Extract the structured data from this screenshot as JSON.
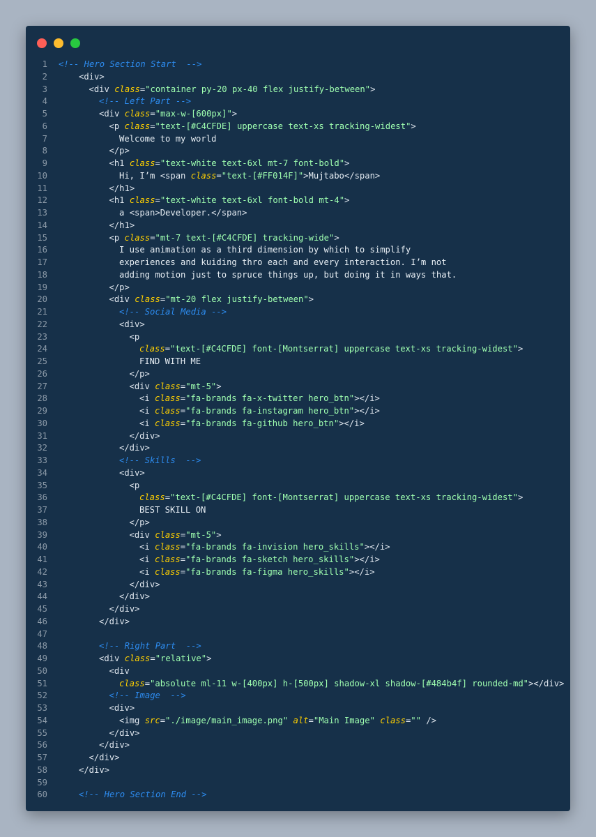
{
  "window": {
    "title_buttons": [
      "close",
      "minimize",
      "zoom"
    ],
    "colors": {
      "background": "#163049",
      "comment": "#2D8CF0",
      "tag": "#DFE6EE",
      "attr": "#FFD000",
      "string": "#9FFFB0",
      "line_number": "#8C9AA8"
    }
  },
  "code": {
    "lines": [
      {
        "n": "1",
        "indent": 0,
        "segs": [
          {
            "k": "c",
            "v": "<!-- Hero Section Start  -->"
          }
        ]
      },
      {
        "n": "2",
        "indent": 2,
        "segs": [
          {
            "k": "t",
            "v": "<div>"
          }
        ]
      },
      {
        "n": "3",
        "indent": 3,
        "segs": [
          {
            "k": "t",
            "v": "<div "
          },
          {
            "k": "a",
            "v": "class"
          },
          {
            "k": "t",
            "v": "="
          },
          {
            "k": "s",
            "v": "\"container py-20 px-40 flex justify-between\""
          },
          {
            "k": "t",
            "v": ">"
          }
        ]
      },
      {
        "n": "4",
        "indent": 4,
        "segs": [
          {
            "k": "c",
            "v": "<!-- Left Part -->"
          }
        ]
      },
      {
        "n": "5",
        "indent": 4,
        "segs": [
          {
            "k": "t",
            "v": "<div "
          },
          {
            "k": "a",
            "v": "class"
          },
          {
            "k": "t",
            "v": "="
          },
          {
            "k": "s",
            "v": "\"max-w-[600px]\""
          },
          {
            "k": "t",
            "v": ">"
          }
        ]
      },
      {
        "n": "6",
        "indent": 5,
        "segs": [
          {
            "k": "t",
            "v": "<p "
          },
          {
            "k": "a",
            "v": "class"
          },
          {
            "k": "t",
            "v": "="
          },
          {
            "k": "s",
            "v": "\"text-[#C4CFDE] uppercase text-xs tracking-widest\""
          },
          {
            "k": "t",
            "v": ">"
          }
        ]
      },
      {
        "n": "7",
        "indent": 6,
        "segs": [
          {
            "k": "p",
            "v": "Welcome to my world"
          }
        ]
      },
      {
        "n": "8",
        "indent": 5,
        "segs": [
          {
            "k": "t",
            "v": "</p>"
          }
        ]
      },
      {
        "n": "9",
        "indent": 5,
        "segs": [
          {
            "k": "t",
            "v": "<h1 "
          },
          {
            "k": "a",
            "v": "class"
          },
          {
            "k": "t",
            "v": "="
          },
          {
            "k": "s",
            "v": "\"text-white text-6xl mt-7 font-bold\""
          },
          {
            "k": "t",
            "v": ">"
          }
        ]
      },
      {
        "n": "10",
        "indent": 6,
        "segs": [
          {
            "k": "p",
            "v": "Hi, I’m "
          },
          {
            "k": "t",
            "v": "<span "
          },
          {
            "k": "a",
            "v": "class"
          },
          {
            "k": "t",
            "v": "="
          },
          {
            "k": "s",
            "v": "\"text-[#FF014F]\""
          },
          {
            "k": "t",
            "v": ">"
          },
          {
            "k": "p",
            "v": "Mujtabo"
          },
          {
            "k": "t",
            "v": "</span>"
          }
        ]
      },
      {
        "n": "11",
        "indent": 5,
        "segs": [
          {
            "k": "t",
            "v": "</h1>"
          }
        ]
      },
      {
        "n": "12",
        "indent": 5,
        "segs": [
          {
            "k": "t",
            "v": "<h1 "
          },
          {
            "k": "a",
            "v": "class"
          },
          {
            "k": "t",
            "v": "="
          },
          {
            "k": "s",
            "v": "\"text-white text-6xl font-bold mt-4\""
          },
          {
            "k": "t",
            "v": ">"
          }
        ]
      },
      {
        "n": "13",
        "indent": 6,
        "segs": [
          {
            "k": "p",
            "v": "a "
          },
          {
            "k": "t",
            "v": "<span>"
          },
          {
            "k": "p",
            "v": "Developer."
          },
          {
            "k": "t",
            "v": "</span>"
          }
        ]
      },
      {
        "n": "14",
        "indent": 5,
        "segs": [
          {
            "k": "t",
            "v": "</h1>"
          }
        ]
      },
      {
        "n": "15",
        "indent": 5,
        "segs": [
          {
            "k": "t",
            "v": "<p "
          },
          {
            "k": "a",
            "v": "class"
          },
          {
            "k": "t",
            "v": "="
          },
          {
            "k": "s",
            "v": "\"mt-7 text-[#C4CFDE] tracking-wide\""
          },
          {
            "k": "t",
            "v": ">"
          }
        ]
      },
      {
        "n": "16",
        "indent": 6,
        "segs": [
          {
            "k": "p",
            "v": "I use animation as a third dimension by which to simplify"
          }
        ]
      },
      {
        "n": "17",
        "indent": 6,
        "segs": [
          {
            "k": "p",
            "v": "experiences and kuiding thro each and every interaction. I’m not"
          }
        ]
      },
      {
        "n": "18",
        "indent": 6,
        "segs": [
          {
            "k": "p",
            "v": "adding motion just to spruce things up, but doing it in ways that."
          }
        ]
      },
      {
        "n": "19",
        "indent": 5,
        "segs": [
          {
            "k": "t",
            "v": "</p>"
          }
        ]
      },
      {
        "n": "20",
        "indent": 5,
        "segs": [
          {
            "k": "t",
            "v": "<div "
          },
          {
            "k": "a",
            "v": "class"
          },
          {
            "k": "t",
            "v": "="
          },
          {
            "k": "s",
            "v": "\"mt-20 flex justify-between\""
          },
          {
            "k": "t",
            "v": ">"
          }
        ]
      },
      {
        "n": "21",
        "indent": 6,
        "segs": [
          {
            "k": "c",
            "v": "<!-- Social Media -->"
          }
        ]
      },
      {
        "n": "22",
        "indent": 6,
        "segs": [
          {
            "k": "t",
            "v": "<div>"
          }
        ]
      },
      {
        "n": "23",
        "indent": 7,
        "segs": [
          {
            "k": "t",
            "v": "<p"
          }
        ]
      },
      {
        "n": "24",
        "indent": 8,
        "segs": [
          {
            "k": "a",
            "v": "class"
          },
          {
            "k": "t",
            "v": "="
          },
          {
            "k": "s",
            "v": "\"text-[#C4CFDE] font-[Montserrat] uppercase text-xs tracking-widest\""
          },
          {
            "k": "t",
            "v": ">"
          }
        ]
      },
      {
        "n": "25",
        "indent": 8,
        "segs": [
          {
            "k": "p",
            "v": "FIND WITH ME"
          }
        ]
      },
      {
        "n": "26",
        "indent": 7,
        "segs": [
          {
            "k": "t",
            "v": "</p>"
          }
        ]
      },
      {
        "n": "27",
        "indent": 7,
        "segs": [
          {
            "k": "t",
            "v": "<div "
          },
          {
            "k": "a",
            "v": "class"
          },
          {
            "k": "t",
            "v": "="
          },
          {
            "k": "s",
            "v": "\"mt-5\""
          },
          {
            "k": "t",
            "v": ">"
          }
        ]
      },
      {
        "n": "28",
        "indent": 8,
        "segs": [
          {
            "k": "t",
            "v": "<i "
          },
          {
            "k": "a",
            "v": "class"
          },
          {
            "k": "t",
            "v": "="
          },
          {
            "k": "s",
            "v": "\"fa-brands fa-x-twitter hero_btn\""
          },
          {
            "k": "t",
            "v": "></i>"
          }
        ]
      },
      {
        "n": "29",
        "indent": 8,
        "segs": [
          {
            "k": "t",
            "v": "<i "
          },
          {
            "k": "a",
            "v": "class"
          },
          {
            "k": "t",
            "v": "="
          },
          {
            "k": "s",
            "v": "\"fa-brands fa-instagram hero_btn\""
          },
          {
            "k": "t",
            "v": "></i>"
          }
        ]
      },
      {
        "n": "30",
        "indent": 8,
        "segs": [
          {
            "k": "t",
            "v": "<i "
          },
          {
            "k": "a",
            "v": "class"
          },
          {
            "k": "t",
            "v": "="
          },
          {
            "k": "s",
            "v": "\"fa-brands fa-github hero_btn\""
          },
          {
            "k": "t",
            "v": "></i>"
          }
        ]
      },
      {
        "n": "31",
        "indent": 7,
        "segs": [
          {
            "k": "t",
            "v": "</div>"
          }
        ]
      },
      {
        "n": "32",
        "indent": 6,
        "segs": [
          {
            "k": "t",
            "v": "</div>"
          }
        ]
      },
      {
        "n": "33",
        "indent": 6,
        "segs": [
          {
            "k": "c",
            "v": "<!-- Skills  -->"
          }
        ]
      },
      {
        "n": "34",
        "indent": 6,
        "segs": [
          {
            "k": "t",
            "v": "<div>"
          }
        ]
      },
      {
        "n": "35",
        "indent": 7,
        "segs": [
          {
            "k": "t",
            "v": "<p"
          }
        ]
      },
      {
        "n": "36",
        "indent": 8,
        "segs": [
          {
            "k": "a",
            "v": "class"
          },
          {
            "k": "t",
            "v": "="
          },
          {
            "k": "s",
            "v": "\"text-[#C4CFDE] font-[Montserrat] uppercase text-xs tracking-widest\""
          },
          {
            "k": "t",
            "v": ">"
          }
        ]
      },
      {
        "n": "37",
        "indent": 8,
        "segs": [
          {
            "k": "p",
            "v": "BEST SKILL ON"
          }
        ]
      },
      {
        "n": "38",
        "indent": 7,
        "segs": [
          {
            "k": "t",
            "v": "</p>"
          }
        ]
      },
      {
        "n": "39",
        "indent": 7,
        "segs": [
          {
            "k": "t",
            "v": "<div "
          },
          {
            "k": "a",
            "v": "class"
          },
          {
            "k": "t",
            "v": "="
          },
          {
            "k": "s",
            "v": "\"mt-5\""
          },
          {
            "k": "t",
            "v": ">"
          }
        ]
      },
      {
        "n": "40",
        "indent": 8,
        "segs": [
          {
            "k": "t",
            "v": "<i "
          },
          {
            "k": "a",
            "v": "class"
          },
          {
            "k": "t",
            "v": "="
          },
          {
            "k": "s",
            "v": "\"fa-brands fa-invision hero_skills\""
          },
          {
            "k": "t",
            "v": "></i>"
          }
        ]
      },
      {
        "n": "41",
        "indent": 8,
        "segs": [
          {
            "k": "t",
            "v": "<i "
          },
          {
            "k": "a",
            "v": "class"
          },
          {
            "k": "t",
            "v": "="
          },
          {
            "k": "s",
            "v": "\"fa-brands fa-sketch hero_skills\""
          },
          {
            "k": "t",
            "v": "></i>"
          }
        ]
      },
      {
        "n": "42",
        "indent": 8,
        "segs": [
          {
            "k": "t",
            "v": "<i "
          },
          {
            "k": "a",
            "v": "class"
          },
          {
            "k": "t",
            "v": "="
          },
          {
            "k": "s",
            "v": "\"fa-brands fa-figma hero_skills\""
          },
          {
            "k": "t",
            "v": "></i>"
          }
        ]
      },
      {
        "n": "43",
        "indent": 7,
        "segs": [
          {
            "k": "t",
            "v": "</div>"
          }
        ]
      },
      {
        "n": "44",
        "indent": 6,
        "segs": [
          {
            "k": "t",
            "v": "</div>"
          }
        ]
      },
      {
        "n": "45",
        "indent": 5,
        "segs": [
          {
            "k": "t",
            "v": "</div>"
          }
        ]
      },
      {
        "n": "46",
        "indent": 4,
        "segs": [
          {
            "k": "t",
            "v": "</div>"
          }
        ]
      },
      {
        "n": "47",
        "indent": 0,
        "segs": []
      },
      {
        "n": "48",
        "indent": 4,
        "segs": [
          {
            "k": "c",
            "v": "<!-- Right Part  -->"
          }
        ]
      },
      {
        "n": "49",
        "indent": 4,
        "segs": [
          {
            "k": "t",
            "v": "<div "
          },
          {
            "k": "a",
            "v": "class"
          },
          {
            "k": "t",
            "v": "="
          },
          {
            "k": "s",
            "v": "\"relative\""
          },
          {
            "k": "t",
            "v": ">"
          }
        ]
      },
      {
        "n": "50",
        "indent": 5,
        "segs": [
          {
            "k": "t",
            "v": "<div"
          }
        ]
      },
      {
        "n": "51",
        "indent": 6,
        "segs": [
          {
            "k": "a",
            "v": "class"
          },
          {
            "k": "t",
            "v": "="
          },
          {
            "k": "s",
            "v": "\"absolute ml-11 w-[400px] h-[500px] shadow-xl shadow-[#484b4f] rounded-md\""
          },
          {
            "k": "t",
            "v": "></div>"
          }
        ]
      },
      {
        "n": "52",
        "indent": 5,
        "segs": [
          {
            "k": "c",
            "v": "<!-- Image  -->"
          }
        ]
      },
      {
        "n": "53",
        "indent": 5,
        "segs": [
          {
            "k": "t",
            "v": "<div>"
          }
        ]
      },
      {
        "n": "54",
        "indent": 6,
        "segs": [
          {
            "k": "t",
            "v": "<img "
          },
          {
            "k": "a",
            "v": "src"
          },
          {
            "k": "t",
            "v": "="
          },
          {
            "k": "s",
            "v": "\"./image/main_image.png\""
          },
          {
            "k": "t",
            "v": " "
          },
          {
            "k": "a",
            "v": "alt"
          },
          {
            "k": "t",
            "v": "="
          },
          {
            "k": "s",
            "v": "\"Main Image\""
          },
          {
            "k": "t",
            "v": " "
          },
          {
            "k": "a",
            "v": "class"
          },
          {
            "k": "t",
            "v": "="
          },
          {
            "k": "s",
            "v": "\"\""
          },
          {
            "k": "t",
            "v": " />"
          }
        ]
      },
      {
        "n": "55",
        "indent": 5,
        "segs": [
          {
            "k": "t",
            "v": "</div>"
          }
        ]
      },
      {
        "n": "56",
        "indent": 4,
        "segs": [
          {
            "k": "t",
            "v": "</div>"
          }
        ]
      },
      {
        "n": "57",
        "indent": 3,
        "segs": [
          {
            "k": "t",
            "v": "</div>"
          }
        ]
      },
      {
        "n": "58",
        "indent": 2,
        "segs": [
          {
            "k": "t",
            "v": "</div>"
          }
        ]
      },
      {
        "n": "59",
        "indent": 0,
        "segs": []
      },
      {
        "n": "60",
        "indent": 2,
        "segs": [
          {
            "k": "c",
            "v": "<!-- Hero Section End -->"
          }
        ]
      }
    ]
  }
}
